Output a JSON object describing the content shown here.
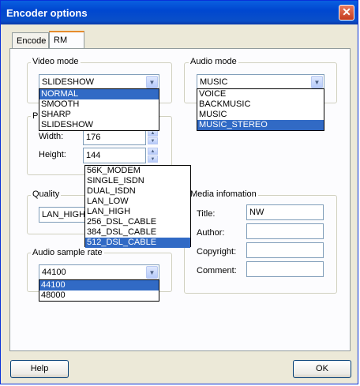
{
  "window": {
    "title": "Encoder options",
    "close_glyph": "✕"
  },
  "tabs": [
    {
      "label": "Encode"
    },
    {
      "label": "RM"
    }
  ],
  "video_mode": {
    "label": "Video mode",
    "selected": "SLIDESHOW",
    "options": [
      "NORMAL",
      "SMOOTH",
      "SHARP",
      "SLIDESHOW"
    ],
    "highlighted": "NORMAL"
  },
  "audio_mode": {
    "label": "Audio mode",
    "selected": "MUSIC",
    "options": [
      "VOICE",
      "BACKMUSIC",
      "MUSIC",
      "MUSIC_STEREO"
    ],
    "highlighted": "MUSIC_STEREO"
  },
  "picture": {
    "label_partial": "P",
    "width_label": "Width:",
    "width_value": "176",
    "height_label": "Height:",
    "height_value": "144"
  },
  "quality": {
    "label": "Quality",
    "selected": "LAN_HIGH",
    "options": [
      "56K_MODEM",
      "SINGLE_ISDN",
      "DUAL_ISDN",
      "LAN_LOW",
      "LAN_HIGH",
      "256_DSL_CABLE",
      "384_DSL_CABLE",
      "512_DSL_CABLE"
    ],
    "highlighted": "512_DSL_CABLE"
  },
  "audio_sample_rate": {
    "label": "Audio sample rate",
    "selected": "44100",
    "options": [
      "44100",
      "48000"
    ],
    "highlighted": "44100"
  },
  "media_info": {
    "label": "Media infomation",
    "title_label": "Title:",
    "title_value": "NW",
    "author_label": "Author:",
    "author_value": "",
    "copyright_label": "Copyright:",
    "copyright_value": "",
    "comment_label": "Comment:",
    "comment_value": ""
  },
  "buttons": {
    "help": "Help",
    "ok": "OK"
  },
  "icons": {
    "dropdown": "chevron-down-icon",
    "spin_up": "arrow-up-icon",
    "spin_down": "arrow-down-icon"
  }
}
